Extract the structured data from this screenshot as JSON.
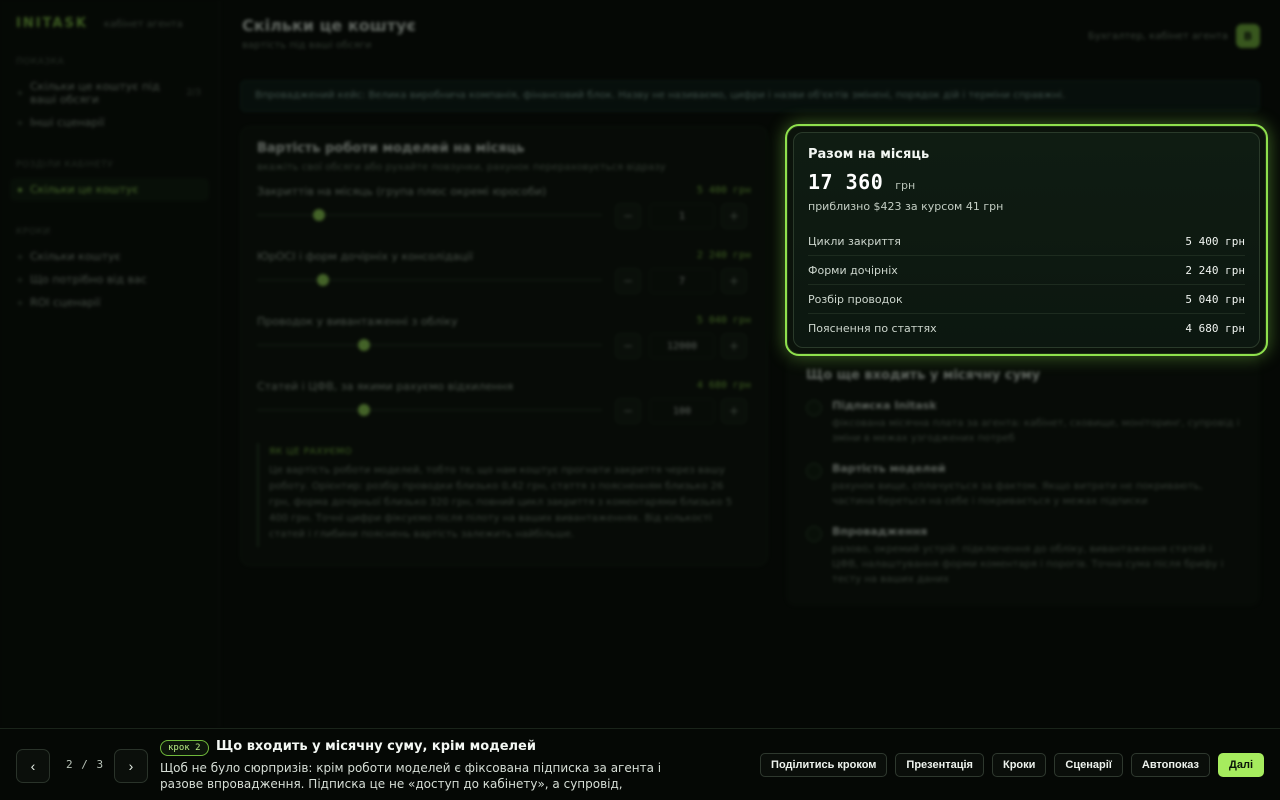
{
  "app": {
    "logo": "INITASK",
    "logo_sub": "кабінет агента"
  },
  "sidebar": {
    "section1": "ПОКАЗКА",
    "items1": [
      {
        "label": "Скільки це коштує під ваші обсяги",
        "count": "2/3"
      },
      {
        "label": "Інші сценарії",
        "count": ""
      }
    ],
    "section2": "РОЗДІЛИ КАБІНЕТУ",
    "active": "Скільки це коштує",
    "section3": "КРОКИ",
    "items3": [
      "Скільки коштує",
      "Що потрібно від вас",
      "ROI сценарії"
    ]
  },
  "header": {
    "title": "Скільки це коштує",
    "subtitle": "вартість під ваші обсяги",
    "user": "Бухгалтер, кабінет агента",
    "avatar": "В"
  },
  "notice": "Впроваджений кейс: Велика виробнича компанія, фінансовий блок. Назву не називаємо, цифри і назви об'єктів змінені, порядок дій і терміни справжні.",
  "calculator": {
    "title": "Вартість роботи моделей на місяць",
    "subtitle": "вкажіть свої обсяги або рухайте повзунки, рахунок перераховується відразу",
    "params": [
      {
        "label": "Закриттів на місяць (група плюс окремі юрособи)",
        "value": "5 400 грн",
        "input": "1",
        "pos": 0.18
      },
      {
        "label": "ЮрОСІ і форм дочірніх у консолідації",
        "value": "2 240 грн",
        "input": "7",
        "pos": 0.19
      },
      {
        "label": "Проводок у вивантаженні з обліку",
        "value": "5 040 грн",
        "input": "12000",
        "pos": 0.31
      },
      {
        "label": "Статей і ЦФВ, за якими рахуємо відхилення",
        "value": "4 680 грн",
        "input": "100",
        "pos": 0.31
      }
    ],
    "note_title": "ЯК ЦЕ РАХУЄМО",
    "note_text": "Це вартість роботи моделей, тобто те, що нам коштує прогнати закриття через вашу роботу. Орієнтир: розбір проводки близько 0,42 грн, стаття з поясненням близько 26 грн, форма дочірньої близько 320 грн, повний цикл закриття з коментарями близько 5 400 грн. Точні цифри фіксуємо після пілоту на ваших вивантаженнях. Від кількості статей і глибини пояснень вартість залежить найбільше."
  },
  "summary": {
    "title": "Разом на місяць",
    "total": "17 360",
    "unit": "грн",
    "approx": "приблизно $423 за курсом 41 грн",
    "rows": [
      {
        "label": "Цикли закриття",
        "value": "5 400 грн"
      },
      {
        "label": "Форми дочірніх",
        "value": "2 240 грн"
      },
      {
        "label": "Розбір проводок",
        "value": "5 040 грн"
      },
      {
        "label": "Пояснення по статтях",
        "value": "4 680 грн"
      }
    ]
  },
  "included": {
    "title": "Що ще входить у місячну суму",
    "items": [
      {
        "name": "Підписка Initask",
        "desc": "фіксована місячна плата за агента: кабінет, сховище, моніторинг, супровід і зміни в межах узгоджених потреб"
      },
      {
        "name": "Вартість моделей",
        "desc": "рахунок вище, сплачується за фактом. Якщо витрати не покривають, частина береться на себе і покривається у межах підписки"
      },
      {
        "name": "Впровадження",
        "desc": "разово, окремий устрій: підключення до обліку, вивантаження статей і ЦФВ, налаштування форми коментаря і порогів. Точна сума після брифу і тесту на ваших даних"
      }
    ]
  },
  "tour": {
    "prev_icon": "‹",
    "next_icon": "›",
    "counter": "2 / 3",
    "step_badge": "крок 2",
    "title": "Що входить у місячну суму, крім моделей",
    "text": "Щоб не було сюрпризів: крім роботи моделей є фіксована підписка за агента і разове впровадження. Підписка це не «доступ до кабінету», а супровід, моніторинг і зміни в…",
    "actions": [
      "Поділитись кроком",
      "Презентація",
      "Кроки",
      "Сценарії",
      "Автопоказ"
    ],
    "primary": "Далі"
  },
  "colors": {
    "accent": "#a6ec5e",
    "background": "#050805"
  }
}
